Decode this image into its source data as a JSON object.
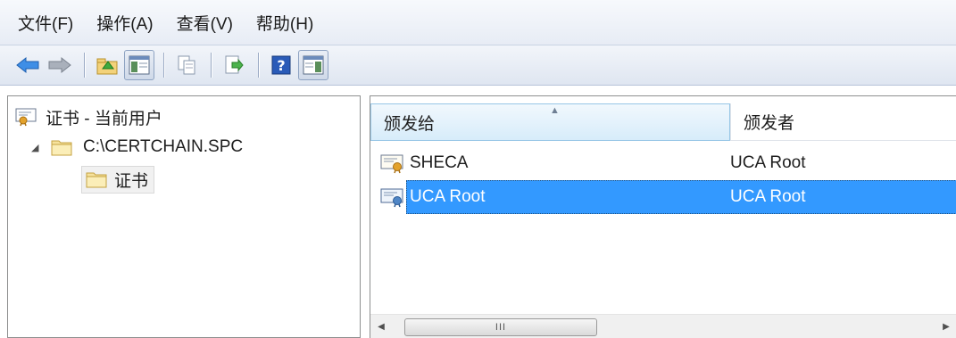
{
  "menu": {
    "file": "文件(F)",
    "action": "操作(A)",
    "view": "查看(V)",
    "help": "帮助(H)"
  },
  "icons": {
    "back": "back-arrow-icon",
    "forward": "forward-arrow-icon",
    "up": "up-folder-icon",
    "show_tree": "show-hide-console-tree-icon",
    "copy": "copy-icon",
    "export": "export-list-icon",
    "help": "help-icon",
    "action_pane": "show-hide-action-pane-icon"
  },
  "tree": {
    "root_label": "证书 - 当前用户",
    "file_label": "C:\\CERTCHAIN.SPC",
    "cert_folder_label": "证书"
  },
  "list": {
    "columns": [
      "颁发给",
      "颁发者"
    ],
    "rows": [
      {
        "issued_to": "SHECA",
        "issuer": "UCA Root",
        "selected": false
      },
      {
        "issued_to": "UCA Root",
        "issuer": "UCA Root",
        "selected": true
      }
    ],
    "scroll_thumb_grip": "III"
  },
  "colors": {
    "selection": "#3399ff",
    "header_active": "#d7ecfa"
  }
}
